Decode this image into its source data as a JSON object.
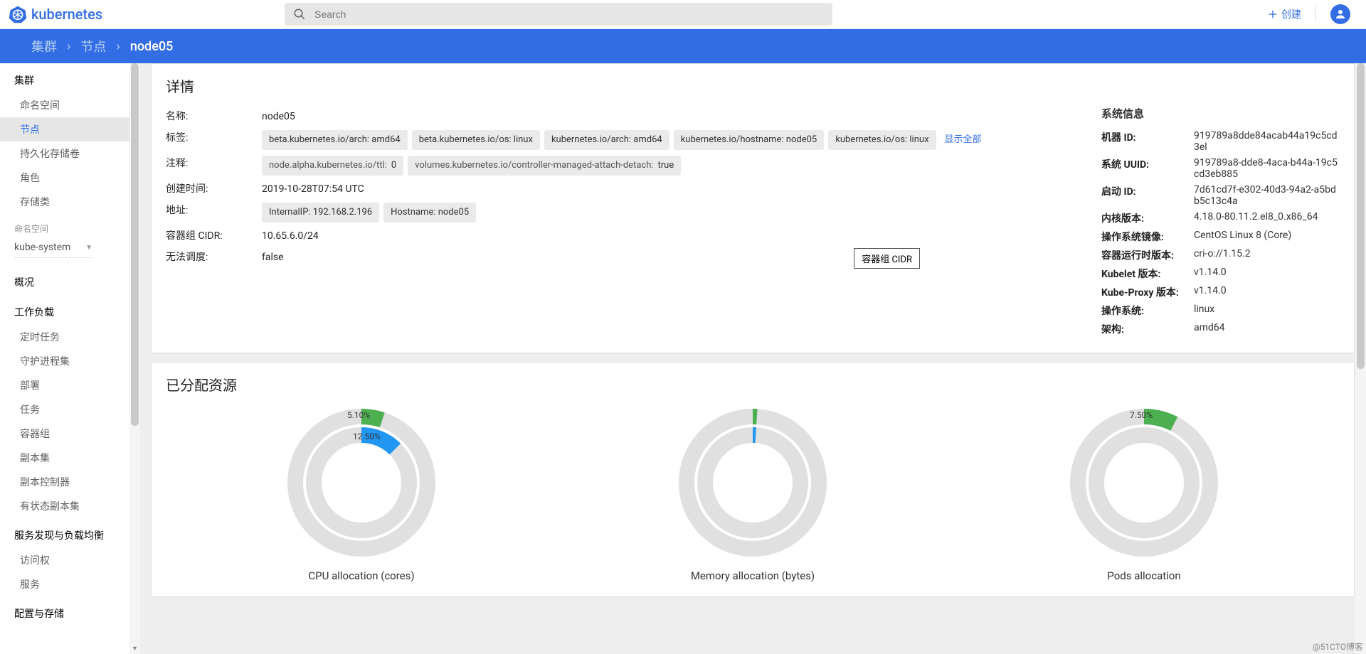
{
  "header": {
    "brand": "kubernetes",
    "search_placeholder": "Search",
    "create_label": "创建"
  },
  "breadcrumbs": {
    "root": "集群",
    "level1": "节点",
    "current": "node05"
  },
  "sidebar": {
    "cluster_header": "集群",
    "cluster_items": [
      "命名空间",
      "节点",
      "持久化存储卷",
      "角色",
      "存储类"
    ],
    "active_index": 1,
    "ns_label": "命名空间",
    "ns_value": "kube-system",
    "overview": "概况",
    "workloads_header": "工作负载",
    "workloads_items": [
      "定时任务",
      "守护进程集",
      "部署",
      "任务",
      "容器组",
      "副本集",
      "副本控制器",
      "有状态副本集"
    ],
    "discovery_header": "服务发现与负载均衡",
    "discovery_items": [
      "访问权",
      "服务"
    ],
    "config_header": "配置与存储"
  },
  "details": {
    "title": "详情",
    "name_label": "名称:",
    "name_value": "node05",
    "labels_label": "标签:",
    "labels": [
      "beta.kubernetes.io/arch: amd64",
      "beta.kubernetes.io/os: linux",
      "kubernetes.io/arch: amd64",
      "kubernetes.io/hostname: node05",
      "kubernetes.io/os: linux"
    ],
    "show_all": "显示全部",
    "annotations_label": "注释:",
    "annotations": [
      {
        "k": "node.alpha.kubernetes.io/ttl:",
        "v": "0"
      },
      {
        "k": "volumes.kubernetes.io/controller-managed-attach-detach:",
        "v": "true"
      }
    ],
    "created_label": "创建时间:",
    "created_value": "2019-10-28T07:54 UTC",
    "address_label": "地址:",
    "addresses": [
      "InternalIP: 192.168.2.196",
      "Hostname: node05"
    ],
    "podcidr_label": "容器组 CIDR:",
    "podcidr_value": "10.65.6.0/24",
    "unsched_label": "无法调度:",
    "unsched_value": "false",
    "cidr_button": "容器组 CIDR"
  },
  "sysinfo": {
    "title": "系统信息",
    "rows": [
      {
        "k": "机器 ID:",
        "v": "919789a8dde84acab44a19c5cd3el"
      },
      {
        "k": "系统 UUID:",
        "v": "919789a8-dde8-4aca-b44a-19c5cd3eb885"
      },
      {
        "k": "启动 ID:",
        "v": "7d61cd7f-e302-40d3-94a2-a5bdb5c13c4a"
      },
      {
        "k": "内核版本:",
        "v": "4.18.0-80.11.2.el8_0.x86_64"
      },
      {
        "k": "操作系统镜像:",
        "v": "CentOS Linux 8 (Core)"
      },
      {
        "k": "容器运行时版本:",
        "v": "cri-o://1.15.2"
      },
      {
        "k": "Kubelet 版本:",
        "v": "v1.14.0"
      },
      {
        "k": "Kube-Proxy 版本:",
        "v": "v1.14.0"
      },
      {
        "k": "操作系统:",
        "v": "linux"
      },
      {
        "k": "架构:",
        "v": "amd64"
      }
    ]
  },
  "allocated": {
    "title": "已分配资源",
    "charts": [
      {
        "title": "CPU allocation (cores)",
        "outer_pct": 5.1,
        "inner_pct": 12.5,
        "outer_label": "5.10%",
        "inner_label": "12.50%"
      },
      {
        "title": "Memory allocation (bytes)",
        "outer_pct": 1.0,
        "inner_pct": 1.0
      },
      {
        "title": "Pods allocation",
        "outer_pct": 7.5,
        "outer_label": "7.50%"
      }
    ]
  },
  "chart_data": [
    {
      "type": "pie",
      "title": "CPU allocation (cores)",
      "series": [
        {
          "name": "outer",
          "values": [
            5.1,
            94.9
          ],
          "labels": [
            "5.10%",
            ""
          ]
        },
        {
          "name": "inner",
          "values": [
            12.5,
            87.5
          ],
          "labels": [
            "12.50%",
            ""
          ]
        }
      ],
      "colors": {
        "outer_fill": "#4caf50",
        "inner_fill": "#2196f3",
        "empty": "#e0e0e0"
      }
    },
    {
      "type": "pie",
      "title": "Memory allocation (bytes)",
      "series": [
        {
          "name": "outer",
          "values": [
            1.0,
            99.0
          ]
        },
        {
          "name": "inner",
          "values": [
            1.0,
            99.0
          ]
        }
      ],
      "colors": {
        "outer_fill": "#4caf50",
        "inner_fill": "#2196f3",
        "empty": "#e0e0e0"
      }
    },
    {
      "type": "pie",
      "title": "Pods allocation",
      "series": [
        {
          "name": "outer",
          "values": [
            7.5,
            92.5
          ],
          "labels": [
            "7.50%",
            ""
          ]
        }
      ],
      "colors": {
        "outer_fill": "#4caf50",
        "empty": "#e0e0e0"
      }
    }
  ],
  "watermark": "@51CTO博客"
}
